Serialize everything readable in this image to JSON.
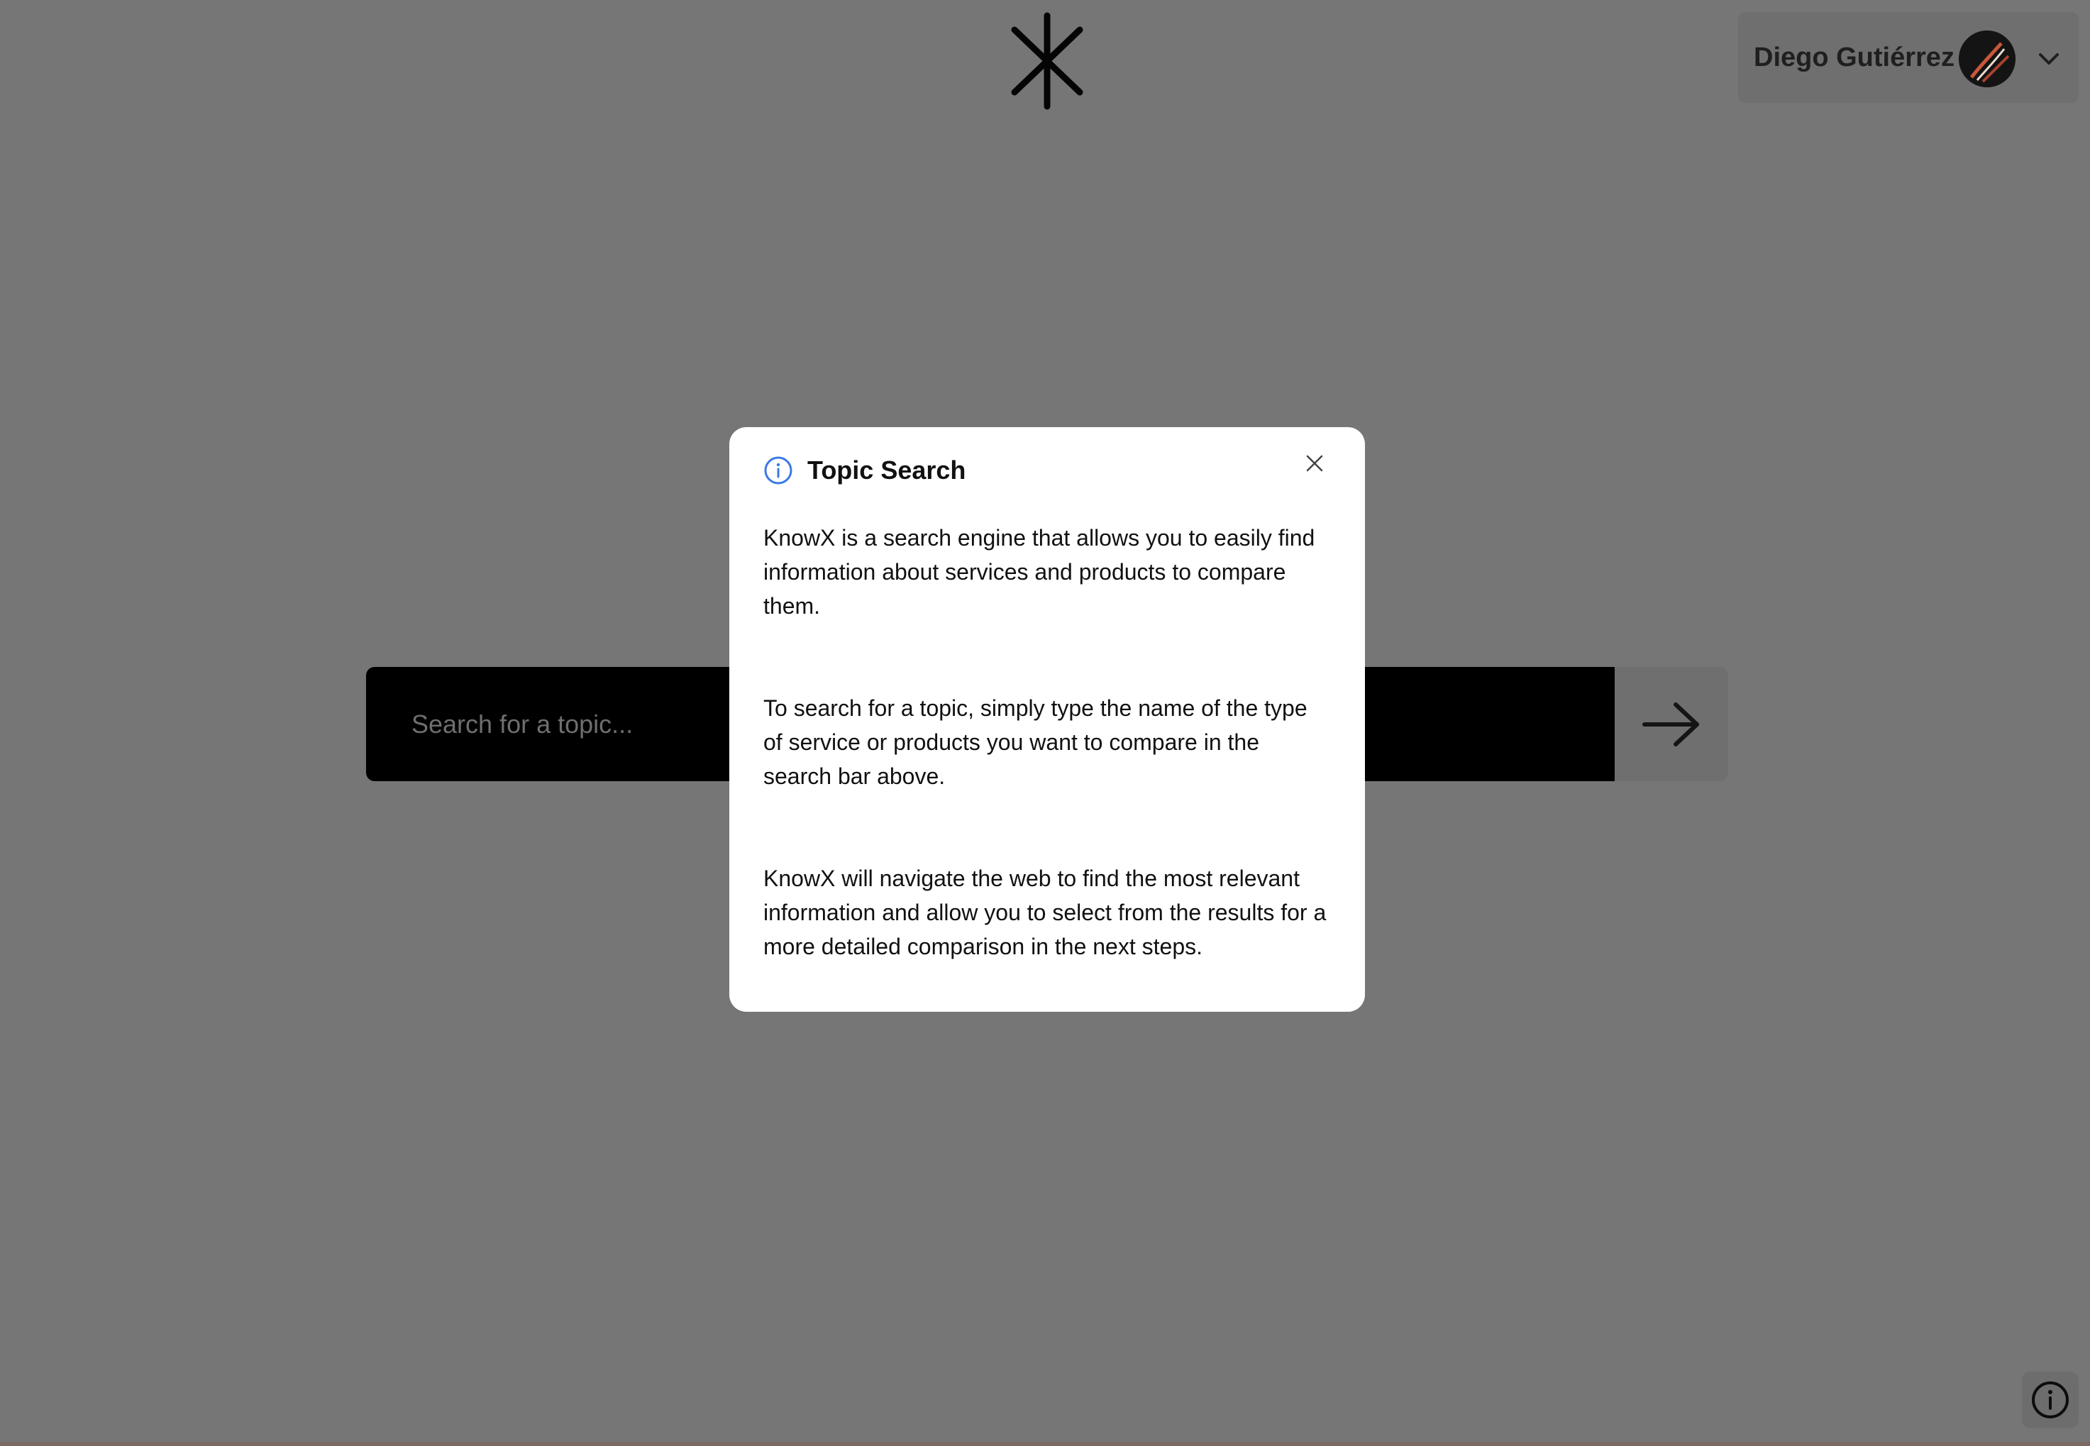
{
  "header": {
    "logo_icon": "asterisk-logo-icon",
    "user": {
      "name": "Diego Gutiérrez",
      "avatar_icon": "user-avatar",
      "menu_icon": "chevron-down-icon"
    }
  },
  "search": {
    "placeholder": "Search for a topic...",
    "submit_icon": "arrow-right-icon"
  },
  "modal": {
    "title": "Topic Search",
    "title_icon": "info-icon",
    "close_icon": "close-icon",
    "paragraphs": [
      "KnowX is a search engine that allows you to easily find information about services and products to compare them.",
      "To search for a topic, simply type the name of the type of service or products you want to compare in the search bar above.",
      "KnowX will navigate the web to find the most relevant information and allow you to select from the results for a more detailed comparison in the next steps."
    ]
  },
  "help_button": {
    "icon": "info-icon"
  },
  "colors": {
    "overlay": "#767676",
    "modal_bg": "#ffffff",
    "search_bg": "#000000",
    "info_accent": "#3b78e7"
  }
}
